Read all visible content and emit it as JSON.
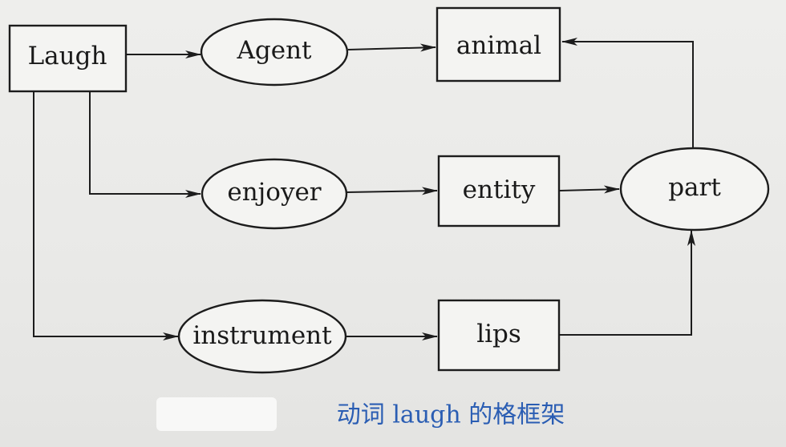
{
  "nodes": {
    "laugh": "Laugh",
    "agent": "Agent",
    "animal": "animal",
    "enjoyer": "enjoyer",
    "entity": "entity",
    "part": "part",
    "instrument": "instrument",
    "lips": "lips"
  },
  "caption": "动词 laugh 的格框架",
  "colors": {
    "ink": "#1c1c1c",
    "caption": "#2a5db3",
    "paper": "#ececea"
  }
}
